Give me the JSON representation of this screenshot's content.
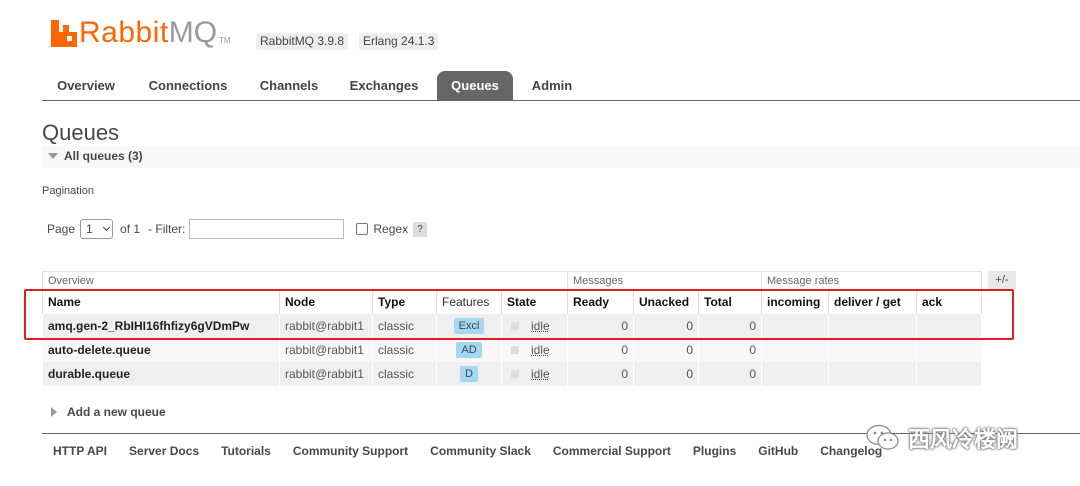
{
  "header": {
    "logo_rabbit": "Rabbit",
    "logo_mq": "MQ",
    "logo_tm": "TM",
    "version_rabbitmq": "RabbitMQ 3.9.8",
    "version_erlang": "Erlang 24.1.3"
  },
  "nav": {
    "items": [
      "Overview",
      "Connections",
      "Channels",
      "Exchanges",
      "Queues",
      "Admin"
    ],
    "active": "Queues"
  },
  "page": {
    "title": "Queues",
    "section_label": "All queues (3)"
  },
  "pagination": {
    "label": "Pagination",
    "page_label": "Page",
    "page_value": "1",
    "of_label": "of 1",
    "filter_label": "- Filter:",
    "filter_value": "",
    "regex_label": "Regex",
    "help_label": "?"
  },
  "table": {
    "group_headers": {
      "overview": "Overview",
      "messages": "Messages",
      "message_rates": "Message rates",
      "toggle": "+/-"
    },
    "columns": {
      "name": "Name",
      "node": "Node",
      "type": "Type",
      "features": "Features",
      "state": "State",
      "ready": "Ready",
      "unacked": "Unacked",
      "total": "Total",
      "incoming": "incoming",
      "deliver_get": "deliver / get",
      "ack": "ack"
    },
    "rows": [
      {
        "name": "amq.gen-2_RbIHI16fhfizy6gVDmPw",
        "node": "rabbit@rabbit1",
        "type": "classic",
        "features": "Excl",
        "state": "idle",
        "ready": "0",
        "unacked": "0",
        "total": "0",
        "incoming": "",
        "deliver_get": "",
        "ack": ""
      },
      {
        "name": "auto-delete.queue",
        "node": "rabbit@rabbit1",
        "type": "classic",
        "features": "AD",
        "state": "idle",
        "ready": "0",
        "unacked": "0",
        "total": "0",
        "incoming": "",
        "deliver_get": "",
        "ack": ""
      },
      {
        "name": "durable.queue",
        "node": "rabbit@rabbit1",
        "type": "classic",
        "features": "D",
        "state": "idle",
        "ready": "0",
        "unacked": "0",
        "total": "0",
        "incoming": "",
        "deliver_get": "",
        "ack": ""
      }
    ]
  },
  "add_queue_label": "Add a new queue",
  "footer": {
    "links": [
      "HTTP API",
      "Server Docs",
      "Tutorials",
      "Community Support",
      "Community Slack",
      "Commercial Support",
      "Plugins",
      "GitHub",
      "Changelog"
    ]
  },
  "watermark": {
    "text": "西风冷楼阙",
    "icon": "wechat-icon"
  },
  "colors": {
    "brand": "#ff6600",
    "nav_active": "#666666",
    "feature_badge": "#a3d8f2",
    "highlight": "#e02020"
  }
}
